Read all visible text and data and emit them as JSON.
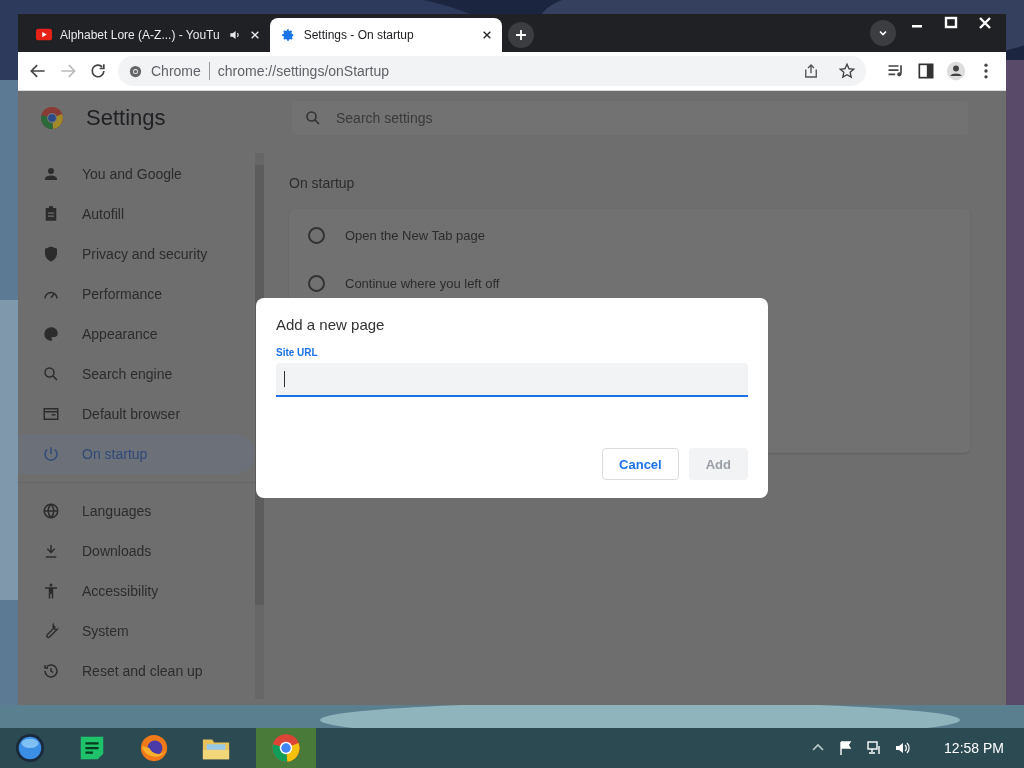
{
  "tabs": [
    {
      "title": "Alphabet Lore (A-Z...) - YouTu",
      "kind": "video",
      "audio": true,
      "selected": false
    },
    {
      "title": "Settings - On startup",
      "kind": "settings",
      "audio": false,
      "selected": true
    }
  ],
  "omnibox": {
    "chip": "Chrome",
    "url": "chrome://settings/onStartup"
  },
  "settings": {
    "title": "Settings",
    "search_placeholder": "Search settings",
    "nav_groups": [
      [
        {
          "label": "You and Google",
          "selected": false
        },
        {
          "label": "Autofill",
          "selected": false
        },
        {
          "label": "Privacy and security",
          "selected": false
        },
        {
          "label": "Performance",
          "selected": false
        },
        {
          "label": "Appearance",
          "selected": false
        },
        {
          "label": "Search engine",
          "selected": false
        },
        {
          "label": "Default browser",
          "selected": false
        },
        {
          "label": "On startup",
          "selected": true
        }
      ],
      [
        {
          "label": "Languages",
          "selected": false
        },
        {
          "label": "Downloads",
          "selected": false
        },
        {
          "label": "Accessibility",
          "selected": false
        },
        {
          "label": "System",
          "selected": false
        },
        {
          "label": "Reset and clean up",
          "selected": false
        }
      ]
    ],
    "section_title": "On startup",
    "options": [
      {
        "label": "Open the New Tab page",
        "selected": false
      },
      {
        "label": "Continue where you left off",
        "selected": false
      }
    ]
  },
  "dialog": {
    "title": "Add a new page",
    "field_label": "Site URL",
    "buttons": [
      {
        "label": "Cancel",
        "disabled": false
      },
      {
        "label": "Add",
        "disabled": true
      }
    ]
  },
  "taskbar": {
    "apps": [
      {
        "kind": "start",
        "selected": false
      },
      {
        "kind": "sheets",
        "selected": false
      },
      {
        "kind": "firefox",
        "selected": false
      },
      {
        "kind": "folder",
        "selected": false
      },
      {
        "kind": "chrome",
        "selected": true
      }
    ],
    "clock": "12:58 PM"
  }
}
